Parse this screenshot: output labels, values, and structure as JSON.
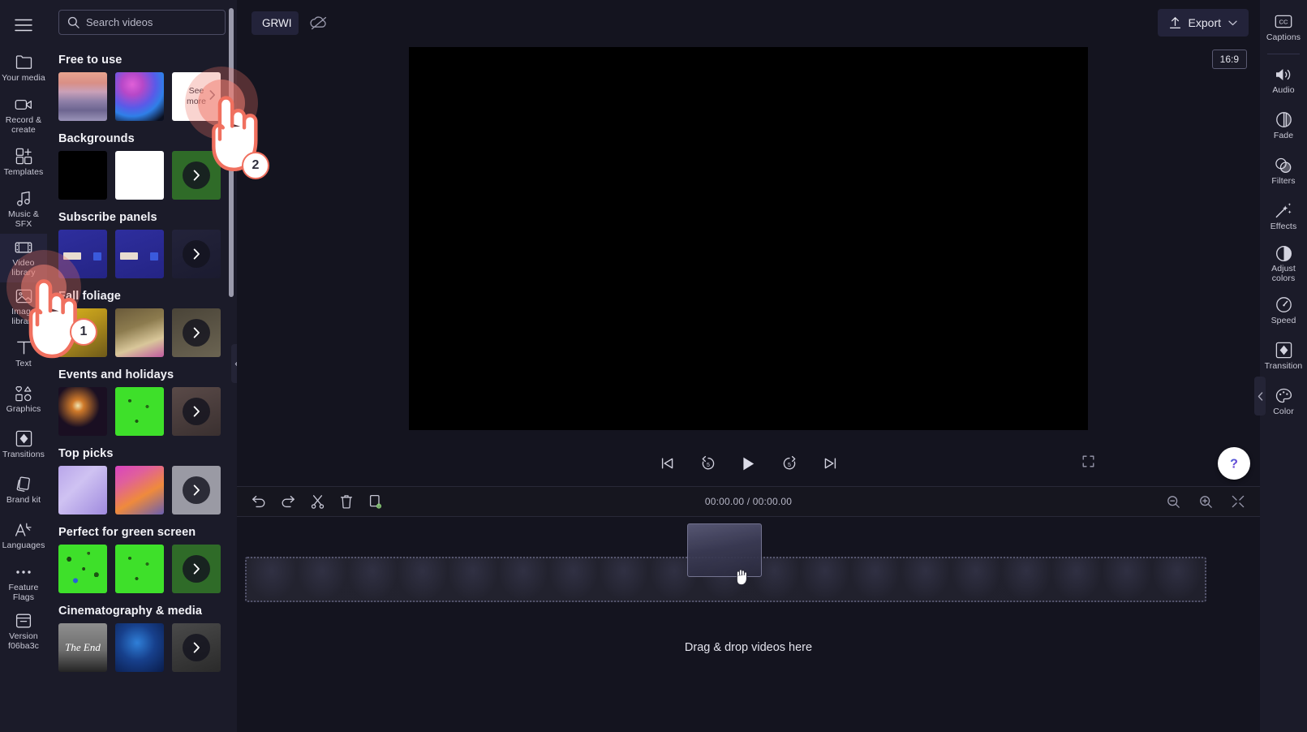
{
  "app": {
    "project_title": "GRWI",
    "export_label": "Export",
    "ratio_badge": "16:9",
    "version_label": "Version\nf06ba3c"
  },
  "left_rail": {
    "menu_icon": "hamburger-icon",
    "items": [
      {
        "label": "Your media",
        "icon": "folder-icon",
        "active": false
      },
      {
        "label": "Record &\ncreate",
        "icon": "video-camera-icon",
        "active": false
      },
      {
        "label": "Templates",
        "icon": "templates-icon",
        "active": false
      },
      {
        "label": "Music & SFX",
        "icon": "music-note-icon",
        "active": false
      },
      {
        "label": "Video library",
        "icon": "film-strip-icon",
        "active": true
      },
      {
        "label": "Image\nlibrary",
        "icon": "image-icon",
        "active": false
      },
      {
        "label": "Text",
        "icon": "text-icon",
        "active": false
      },
      {
        "label": "Graphics",
        "icon": "shapes-icon",
        "active": false
      },
      {
        "label": "Transitions",
        "icon": "transition-icon",
        "active": false
      },
      {
        "label": "Brand kit",
        "icon": "brand-kit-icon",
        "active": false
      },
      {
        "label": "Languages",
        "icon": "translate-icon",
        "active": false
      },
      {
        "label": "Feature\nFlags",
        "icon": "ellipsis-icon",
        "active": false
      },
      {
        "label": "Version\nf06ba3c",
        "icon": "archive-box-icon",
        "active": false
      }
    ]
  },
  "library": {
    "search": {
      "placeholder": "Search videos",
      "value": "",
      "icon": "search-icon"
    },
    "see_more_label": "See\nmore",
    "sections": [
      {
        "title": "Free to use",
        "items": [
          {
            "name": "sunset-beach-thumbnail",
            "kind": "image"
          },
          {
            "name": "pink-blue-ink-thumbnail",
            "kind": "image"
          },
          {
            "name": "see-more-tile",
            "kind": "see-more"
          }
        ]
      },
      {
        "title": "Backgrounds",
        "items": [
          {
            "name": "black-background-thumbnail",
            "kind": "image"
          },
          {
            "name": "white-background-thumbnail",
            "kind": "image"
          },
          {
            "name": "green-background-more-tile",
            "kind": "more"
          }
        ]
      },
      {
        "title": "Subscribe panels",
        "items": [
          {
            "name": "subscribe-panel-blue-thumbnail",
            "kind": "image"
          },
          {
            "name": "subscribe-panel-blue-2-thumbnail",
            "kind": "image"
          },
          {
            "name": "subscribe-panel-more-tile",
            "kind": "more"
          }
        ]
      },
      {
        "title": "Fall foliage",
        "items": [
          {
            "name": "yellow-leaves-thumbnail",
            "kind": "image"
          },
          {
            "name": "autumn-kids-thumbnail",
            "kind": "image"
          },
          {
            "name": "fall-foliage-more-tile",
            "kind": "more"
          }
        ]
      },
      {
        "title": "Events and holidays",
        "items": [
          {
            "name": "fireworks-thumbnail",
            "kind": "image"
          },
          {
            "name": "green-screen-confetti-thumbnail",
            "kind": "image"
          },
          {
            "name": "events-more-tile",
            "kind": "more"
          }
        ]
      },
      {
        "title": "Top picks",
        "items": [
          {
            "name": "purple-diamond-thumbnail",
            "kind": "image"
          },
          {
            "name": "orange-wave-thumbnail",
            "kind": "image"
          },
          {
            "name": "top-picks-more-tile",
            "kind": "more"
          }
        ]
      },
      {
        "title": "Perfect for green screen",
        "items": [
          {
            "name": "green-screen-leaves-thumbnail",
            "kind": "image"
          },
          {
            "name": "green-screen-sparkles-thumbnail",
            "kind": "image"
          },
          {
            "name": "green-screen-more-tile",
            "kind": "more"
          }
        ]
      },
      {
        "title": "Cinematography & media",
        "items": [
          {
            "name": "the-end-thumbnail",
            "kind": "image",
            "caption": "The End"
          },
          {
            "name": "blue-data-map-thumbnail",
            "kind": "image"
          },
          {
            "name": "cinematography-more-tile",
            "kind": "more"
          }
        ]
      }
    ]
  },
  "timeline": {
    "timecode": "00:00.00 / 00:00.00",
    "drop_label": "Drag & drop videos here",
    "tools": [
      {
        "name": "undo-button",
        "icon": "undo-icon"
      },
      {
        "name": "redo-button",
        "icon": "redo-icon"
      },
      {
        "name": "split-button",
        "icon": "scissors-icon"
      },
      {
        "name": "delete-button",
        "icon": "trash-icon"
      },
      {
        "name": "duplicate-button",
        "icon": "duplicate-icon"
      }
    ],
    "zoom_tools": [
      {
        "name": "zoom-out-button",
        "icon": "zoom-out-icon"
      },
      {
        "name": "zoom-in-button",
        "icon": "zoom-in-icon"
      },
      {
        "name": "fit-timeline-button",
        "icon": "fit-icon"
      }
    ]
  },
  "playback": {
    "controls": [
      {
        "name": "skip-to-start-button",
        "icon": "skip-start-icon"
      },
      {
        "name": "back-5s-button",
        "icon": "rewind-5-icon"
      },
      {
        "name": "play-button",
        "icon": "play-icon"
      },
      {
        "name": "forward-5s-button",
        "icon": "forward-5-icon"
      },
      {
        "name": "skip-to-end-button",
        "icon": "skip-end-icon"
      }
    ],
    "fullscreen_icon": "fullscreen-icon"
  },
  "right_rail": {
    "items": [
      {
        "label": "Captions",
        "icon": "closed-caption-icon"
      },
      {
        "label": "Audio",
        "icon": "speaker-icon"
      },
      {
        "label": "Fade",
        "icon": "fade-icon"
      },
      {
        "label": "Filters",
        "icon": "filters-icon"
      },
      {
        "label": "Effects",
        "icon": "magic-wand-icon"
      },
      {
        "label": "Adjust\ncolors",
        "icon": "contrast-icon"
      },
      {
        "label": "Speed",
        "icon": "speedometer-icon"
      },
      {
        "label": "Transition",
        "icon": "transition-icon"
      },
      {
        "label": "Color",
        "icon": "palette-icon"
      }
    ]
  },
  "annotations": [
    {
      "step": "1",
      "target": "sidebar-item-video-library"
    },
    {
      "step": "2",
      "target": "see-more-tile"
    }
  ],
  "colors": {
    "app_background": "#14141f",
    "panel_background": "#1b1b29",
    "accent_annotation": "#f0705f",
    "active_item": "#23233a",
    "green_screen": "#3ee02a"
  }
}
